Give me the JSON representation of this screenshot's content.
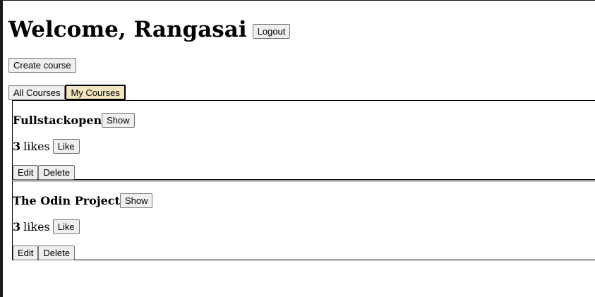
{
  "header": {
    "welcome": "Welcome, Rangasai",
    "logout_label": "Logout"
  },
  "create_label": "Create course",
  "tabs": [
    {
      "label": "All Courses",
      "active": false
    },
    {
      "label": "My Courses",
      "active": true
    }
  ],
  "courses": [
    {
      "title": "Fullstackopen",
      "show_label": "Show",
      "likes": "3",
      "likes_word": "likes",
      "like_label": "Like",
      "edit_label": "Edit",
      "delete_label": "Delete"
    },
    {
      "title": "The Odin Project",
      "show_label": "Show",
      "likes": "3",
      "likes_word": "likes",
      "like_label": "Like",
      "edit_label": "Edit",
      "delete_label": "Delete"
    }
  ],
  "colors": {
    "active_tab_bg": "#f1e4bf",
    "button_bg": "#efefef"
  }
}
